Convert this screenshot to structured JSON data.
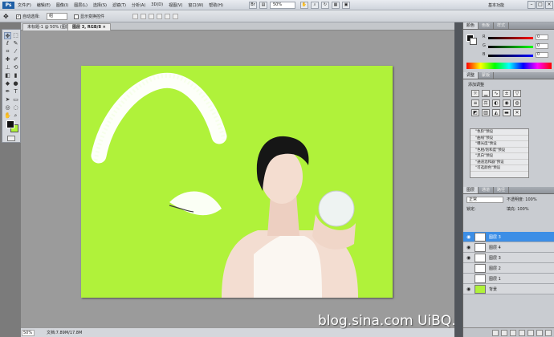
{
  "app": {
    "logo": "Ps",
    "workspace": "基本功能"
  },
  "menu": [
    "文件(F)",
    "编辑(E)",
    "图像(I)",
    "图层(L)",
    "选择(S)",
    "滤镜(T)",
    "分析(A)",
    "3D(D)",
    "视图(V)",
    "窗口(W)",
    "帮助(H)"
  ],
  "appbar": {
    "zoom": "50%"
  },
  "options": {
    "auto_select_label": "自动选择:",
    "auto_select_value": "组",
    "transform_label": "显示变换控件"
  },
  "tabs": [
    {
      "label": "未标题-1 @ 50% (图层 1, RGB/8)"
    },
    {
      "label": "图层 3, RGB/8 ×"
    }
  ],
  "status": {
    "zoom": "50%",
    "doc": "文档:7.89M/17.8M"
  },
  "watermark": "blog.sina.com UiBQ.CoM",
  "colors": {
    "canvas_bg": "#b0f23a",
    "selection": "#3c8ee6"
  },
  "color_panel": {
    "tabs": [
      "颜色",
      "色板",
      "样式"
    ],
    "sliders": [
      {
        "label": "R",
        "value": "0"
      },
      {
        "label": "G",
        "value": "0"
      },
      {
        "label": "B",
        "value": "0"
      }
    ]
  },
  "adjust_panel": {
    "tabs": [
      "调整",
      "蒙版"
    ],
    "title": "添加调整",
    "presets": [
      "\"色阶\"预设",
      "\"曲线\"预设",
      "\"曝光度\"预设",
      "\"色相/饱和度\"预设",
      "\"黑白\"预设",
      "\"通道混和器\"预设",
      "\"可选颜色\"预设"
    ]
  },
  "layers_panel": {
    "tabs": [
      "图层",
      "通道",
      "路径"
    ],
    "blend_mode": "正常",
    "opacity_label": "不透明度:",
    "opacity_value": "100%",
    "lock_label": "锁定:",
    "fill_label": "填充:",
    "fill_value": "100%",
    "layers": [
      {
        "name": "图层 3",
        "selected": true
      },
      {
        "name": "图层 4",
        "selected": false
      },
      {
        "name": "图层 3",
        "selected": false
      },
      {
        "name": "图层 2",
        "selected": false
      },
      {
        "name": "图层 1",
        "selected": false
      },
      {
        "name": "背景",
        "selected": false
      }
    ]
  }
}
